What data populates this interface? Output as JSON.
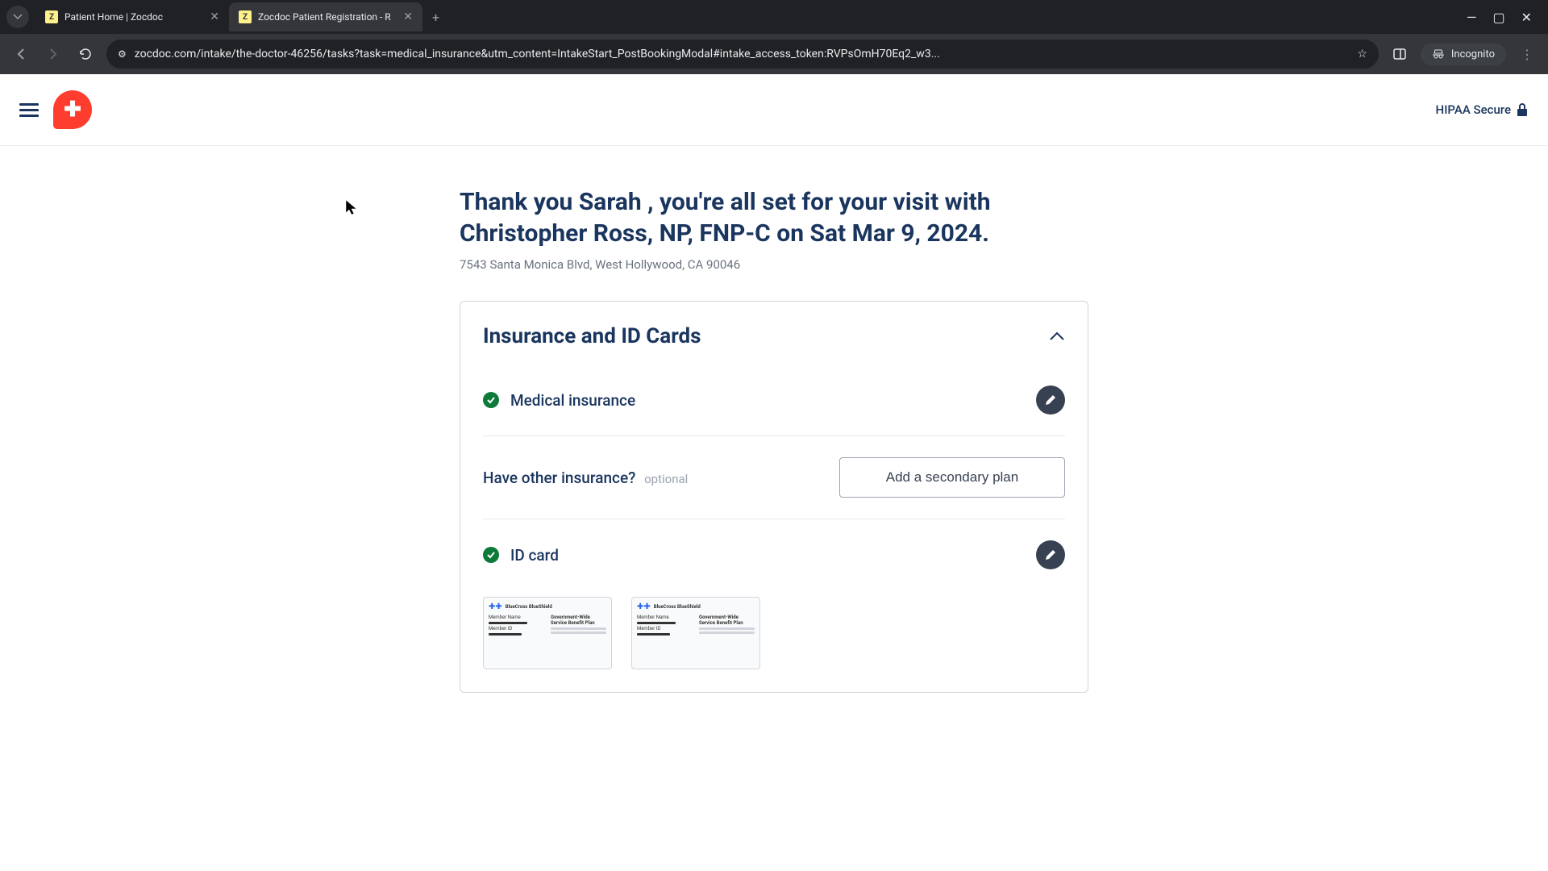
{
  "browser": {
    "tabs": [
      {
        "title": "Patient Home | Zocdoc",
        "active": false
      },
      {
        "title": "Zocdoc Patient Registration - R",
        "active": true
      }
    ],
    "url": "zocdoc.com/intake/the-doctor-46256/tasks?task=medical_insurance&utm_content=IntakeStart_PostBookingModal#intake_access_token:RVPsOmH70Eq2_w3...",
    "incognito_label": "Incognito"
  },
  "header": {
    "hipaa_label": "HIPAA Secure"
  },
  "main": {
    "title": "Thank you Sarah , you're all set for your visit with Christopher Ross, NP, FNP-C on Sat Mar 9, 2024.",
    "address": "7543 Santa Monica Blvd, West Hollywood, CA 90046"
  },
  "card": {
    "title": "Insurance and ID Cards",
    "sections": {
      "medical_insurance": {
        "label": "Medical insurance"
      },
      "other_insurance": {
        "label": "Have other insurance?",
        "optional": "optional",
        "button": "Add a secondary plan"
      },
      "id_card": {
        "label": "ID card"
      }
    }
  },
  "id_card_mock": {
    "brand": "BlueCross BlueShield",
    "plan_line1": "Government-Wide",
    "plan_line2": "Service Benefit Plan",
    "member_label": "Member Name",
    "id_label": "Member ID"
  }
}
